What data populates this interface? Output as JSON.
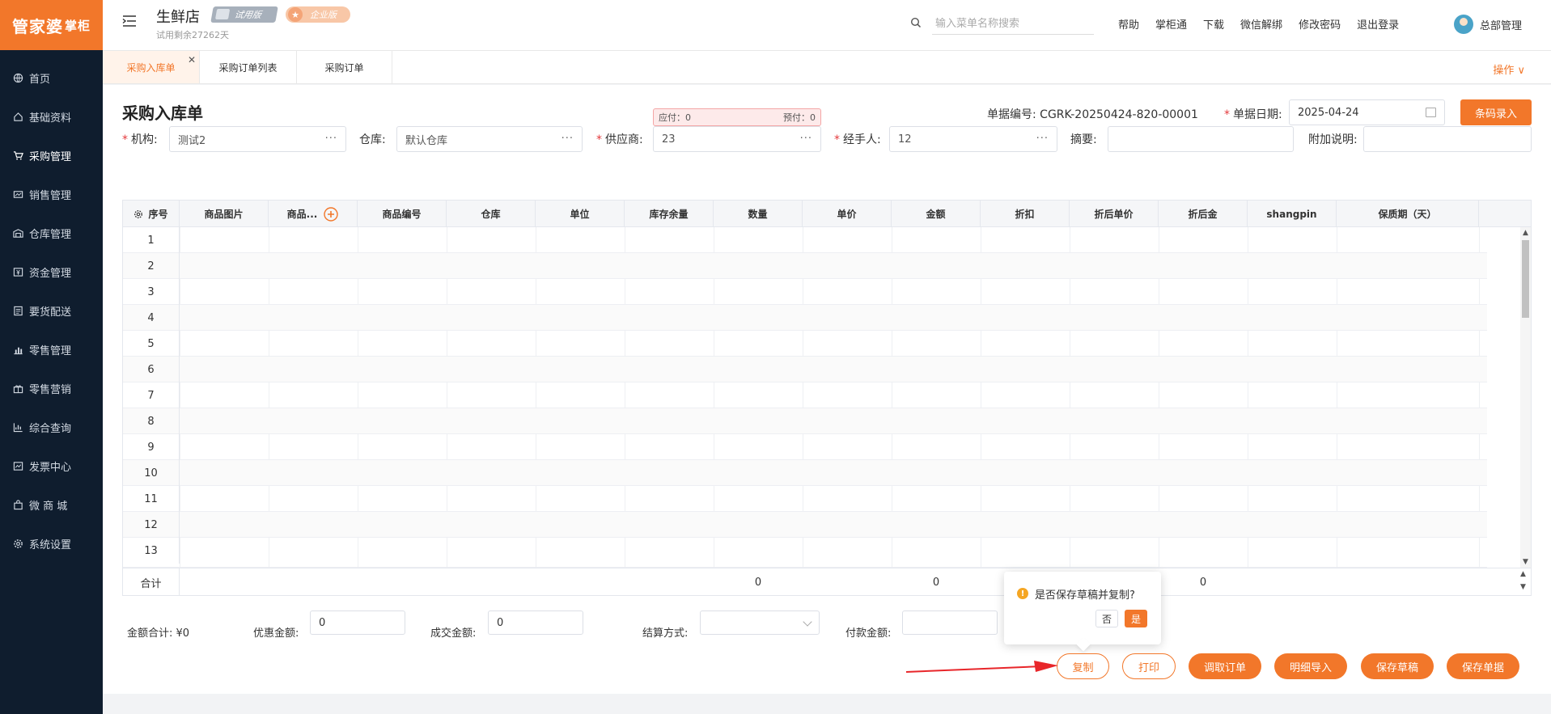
{
  "sidebar": {
    "logo": "管家婆",
    "logo_sub": "掌柜",
    "items": [
      {
        "label": "首页",
        "icon": "globe-icon"
      },
      {
        "label": "基础资料",
        "icon": "home-icon"
      },
      {
        "label": "采购管理",
        "icon": "cart-icon"
      },
      {
        "label": "销售管理",
        "icon": "sales-icon"
      },
      {
        "label": "仓库管理",
        "icon": "warehouse-icon"
      },
      {
        "label": "资金管理",
        "icon": "money-icon"
      },
      {
        "label": "要货配送",
        "icon": "document-icon"
      },
      {
        "label": "零售管理",
        "icon": "bar-chart-icon"
      },
      {
        "label": "零售营销",
        "icon": "gift-icon"
      },
      {
        "label": "综合查询",
        "icon": "chart-icon"
      },
      {
        "label": "发票中心",
        "icon": "invoice-icon"
      },
      {
        "label": "微 商 城",
        "icon": "bag-icon"
      },
      {
        "label": "系统设置",
        "icon": "gear-icon"
      }
    ]
  },
  "header": {
    "store_name": "生鲜店",
    "badge_trial": "试用版",
    "badge_enterprise": "企业版",
    "trial_remaining": "试用剩余27262天",
    "search_placeholder": "输入菜单名称搜索",
    "links": [
      "帮助",
      "掌柜通",
      "下载",
      "微信解绑",
      "修改密码",
      "退出登录"
    ],
    "user_name": "总部管理"
  },
  "tabs": [
    {
      "label": "采购入库单",
      "active": true
    },
    {
      "label": "采购订单列表",
      "active": false
    },
    {
      "label": "采购订单",
      "active": false
    }
  ],
  "ops_label": "操作 ∨",
  "form": {
    "title": "采购入库单",
    "doc_no_label": "单据编号:",
    "doc_no": "CGRK-20250424-820-00001",
    "doc_date_label": "单据日期:",
    "doc_date": "2025-04-24",
    "barcode_button": "条码录入",
    "payable": "应付：0",
    "prepaid": "预付：0",
    "org_label": "机构:",
    "org_value": "测试2",
    "warehouse_label": "仓库:",
    "warehouse_value": "默认仓库",
    "supplier_label": "供应商:",
    "supplier_value": "23",
    "handler_label": "经手人:",
    "handler_value": "12",
    "summary_label": "摘要:",
    "summary_value": "",
    "note_label": "附加说明:",
    "note_value": ""
  },
  "table": {
    "columns": [
      "序号",
      "商品图片",
      "商品...",
      "商品编号",
      "仓库",
      "单位",
      "库存余量",
      "数量",
      "单价",
      "金额",
      "折扣",
      "折后单价",
      "折后金",
      "shangpin",
      "保质期（天）"
    ],
    "rows": [
      "1",
      "2",
      "3",
      "4",
      "5",
      "6",
      "7",
      "8",
      "9",
      "10",
      "11",
      "12",
      "13"
    ],
    "footer_label": "合计",
    "footer_qty": "0",
    "footer_amount": "0",
    "footer_disc_amount": "0"
  },
  "summary": {
    "total_label": "金额合计:",
    "total_value": "¥0",
    "discount_label": "优惠金额:",
    "discount_value": "0",
    "deal_label": "成交金额:",
    "deal_value": "0",
    "settle_label": "结算方式:",
    "settle_value": "",
    "pay_label": "付款金额:",
    "pay_value": ""
  },
  "popover": {
    "text": "是否保存草稿并复制?",
    "no": "否",
    "yes": "是"
  },
  "buttons": {
    "copy": "复制",
    "print": "打印",
    "fetch_order": "调取订单",
    "import_detail": "明细导入",
    "save_draft": "保存草稿",
    "save_doc": "保存单据"
  },
  "colors": {
    "accent": "#f2772a",
    "sidebar_bg": "#0f1d2e",
    "annotation_arrow": "#e8262a"
  }
}
